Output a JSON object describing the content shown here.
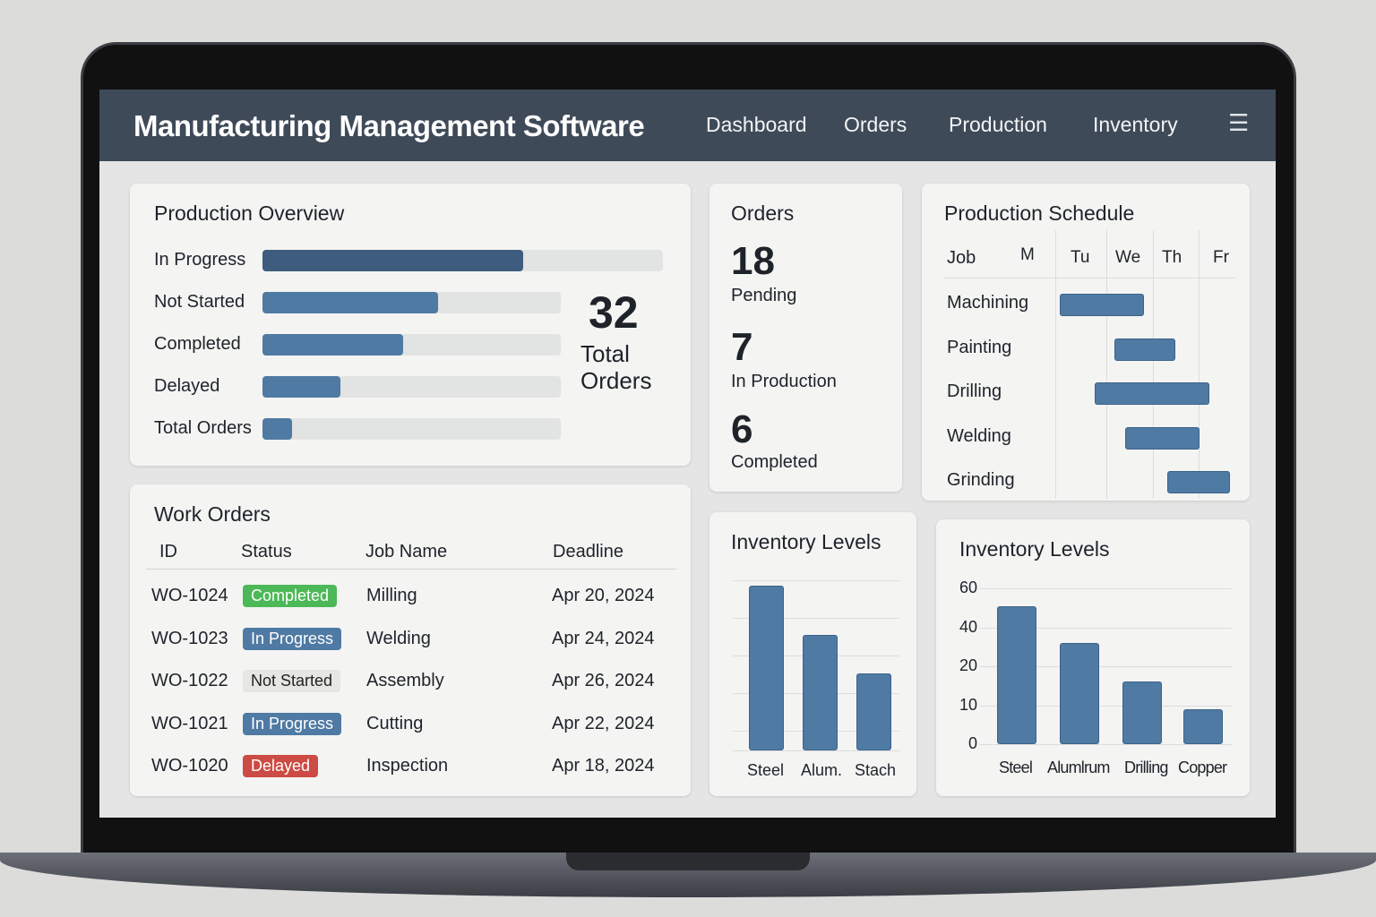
{
  "app": {
    "title": "Manufacturing Management Software",
    "nav": [
      "Dashboard",
      "Orders",
      "Production",
      "Inventory"
    ],
    "menu_icon": "hamburger-icon"
  },
  "overview": {
    "title": "Production Overview",
    "rows": [
      {
        "label": "In Progress",
        "percent": 65
      },
      {
        "label": "Not Started",
        "percent": 59
      },
      {
        "label": "Completed",
        "percent": 47
      },
      {
        "label": "Delayed",
        "percent": 26
      },
      {
        "label": "Total Orders",
        "percent": 10
      }
    ],
    "total_value": "32",
    "total_label_1": "Total",
    "total_label_2": "Orders"
  },
  "orders": {
    "title": "Orders",
    "stats": [
      {
        "value": "18",
        "label": "Pending"
      },
      {
        "value": "7",
        "label": "In Production"
      },
      {
        "value": "6",
        "label": "Completed"
      }
    ]
  },
  "schedule": {
    "title": "Production Schedule",
    "job_header": "Job",
    "days": [
      "M",
      "Tu",
      "We",
      "Th",
      "Fr"
    ],
    "jobs": [
      {
        "name": "Machining",
        "start": 0.1,
        "end": 1.9
      },
      {
        "name": "Painting",
        "start": 1.27,
        "end": 2.58
      },
      {
        "name": "Drilling",
        "start": 0.85,
        "end": 3.3
      },
      {
        "name": "Welding",
        "start": 1.5,
        "end": 3.1
      },
      {
        "name": "Grinding",
        "start": 2.4,
        "end": 3.75
      }
    ]
  },
  "work_orders": {
    "title": "Work Orders",
    "headers": [
      "ID",
      "Status",
      "Job Name",
      "Deadline"
    ],
    "rows": [
      {
        "id": "WO-1024",
        "status": "Completed",
        "job": "Milling",
        "deadline": "Apr 20, 2024"
      },
      {
        "id": "WO-1023",
        "status": "In Progress",
        "job": "Welding",
        "deadline": "Apr 24, 2024"
      },
      {
        "id": "WO-1022",
        "status": "Not Started",
        "job": "Assembly",
        "deadline": "Apr 26, 2024"
      },
      {
        "id": "WO-1021",
        "status": "In Progress",
        "job": "Cutting",
        "deadline": "Apr 22, 2024"
      },
      {
        "id": "WO-1020",
        "status": "Delayed",
        "job": "Inspection",
        "deadline": "Apr 18, 2024"
      }
    ]
  },
  "status_colors": {
    "Completed": "#4cb857",
    "In Progress": "#4f7aa3",
    "Not Started": "#e6e6e4",
    "Delayed": "#cc4b44"
  },
  "chart_data": [
    {
      "type": "bar",
      "title": "Inventory Levels",
      "categories": [
        "Steel",
        "Alum.",
        "Stach"
      ],
      "values": [
        100,
        70,
        47
      ],
      "ylim": [
        0,
        100
      ],
      "grid": true
    },
    {
      "type": "bar",
      "title": "Inventory Levels",
      "categories": [
        "Steel",
        "Alumlrum",
        "Drilling",
        "Copper"
      ],
      "values": [
        51,
        32,
        16,
        9
      ],
      "yticks": [
        "0",
        "10",
        "20",
        "40",
        "60"
      ],
      "ylim": [
        0,
        60
      ],
      "grid": true
    }
  ]
}
